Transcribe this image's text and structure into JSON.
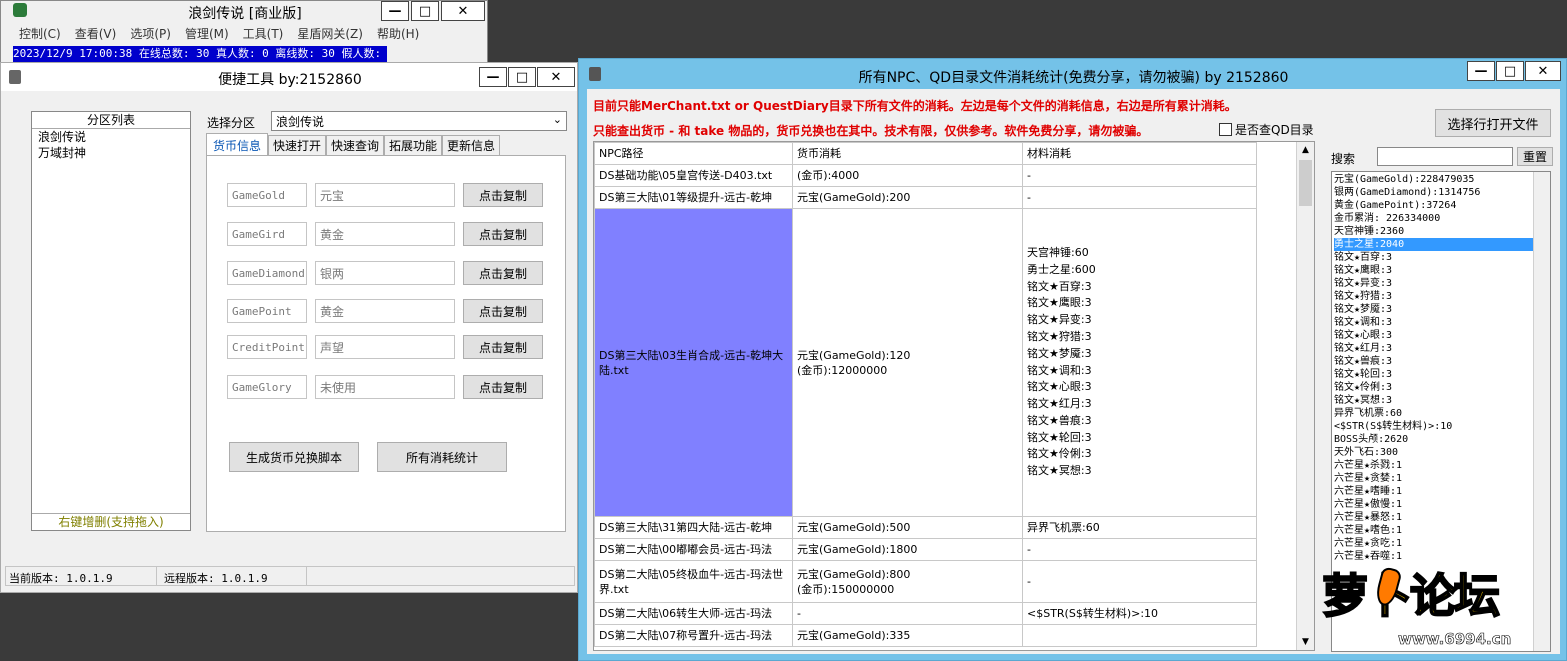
{
  "main_window": {
    "title": "浪剑传说 [商业版]",
    "menu": [
      "控制(C)",
      "查看(V)",
      "选项(P)",
      "管理(M)",
      "工具(T)",
      "星盾网关(Z)",
      "帮助(H)"
    ],
    "status_line": "2023/12/9 17:00:38 在线总数: 30 真人数: 0 离线数: 30 假人数: 0"
  },
  "tool_window": {
    "title": "便捷工具  by:2152860",
    "partition_list_header": "分区列表",
    "partitions": [
      "浪剑传说",
      "万域封神"
    ],
    "list_footer": "右键增删(支持拖入)",
    "select_label": "选择分区",
    "selected_partition": "浪剑传说",
    "tabs": [
      "货币信息",
      "快速打开",
      "快速查询",
      "拓展功能",
      "更新信息"
    ],
    "currencies": [
      {
        "code": "GameGold",
        "name": "元宝",
        "button": "点击复制"
      },
      {
        "code": "GameGird",
        "name": "黄金",
        "button": "点击复制"
      },
      {
        "code": "GameDiamond",
        "name": "银两",
        "button": "点击复制"
      },
      {
        "code": "GamePoint",
        "name": "黄金",
        "button": "点击复制"
      },
      {
        "code": "CreditPoint",
        "name": "声望",
        "button": "点击复制"
      },
      {
        "code": "GameGlory",
        "name": "未使用",
        "button": "点击复制"
      }
    ],
    "gen_button": "生成货币兑换脚本",
    "stats_button": "所有消耗统计",
    "status_local": "当前版本: 1.0.1.9",
    "status_remote": "远程版本: 1.0.1.9"
  },
  "stats_window": {
    "title": "所有NPC、QD目录文件消耗统计(免费分享，请勿被骗)    by 2152860",
    "notice1": "目前只能MerChant.txt or QuestDiary目录下所有文件的消耗。左边是每个文件的消耗信息，右边是所有累计消耗。",
    "notice2": "只能查出货币 - 和 take 物品的，货币兑换也在其中。技术有限，仅供参考。软件免费分享，请勿被骗。",
    "checkbox_label": "是否查QD目录",
    "open_button": "选择行打开文件",
    "search_label": "搜索",
    "reset_button": "重置",
    "columns": [
      "NPC路径",
      "货币消耗",
      "材料消耗"
    ],
    "rows": [
      {
        "path": "DS基础功能\\05皇宫传送-D403.txt",
        "currency": "(金币):4000",
        "material": "-"
      },
      {
        "path": "DS第三大陆\\01等级提升-远古-乾坤",
        "currency": "元宝(GameGold):200",
        "material": "-"
      },
      {
        "path": "DS第三大陆\\03生肖合成-远古-乾坤大陆.txt",
        "currency": "元宝(GameGold):120\n(金币):12000000",
        "material": "天宫神锤:60\n勇士之星:600\n铭文★百穿:3\n铭文★鹰眼:3\n铭文★异变:3\n铭文★狩猎:3\n铭文★梦魇:3\n铭文★调和:3\n铭文★心眼:3\n铭文★红月:3\n铭文★兽痕:3\n铭文★轮回:3\n铭文★伶俐:3\n铭文★冥想:3"
      },
      {
        "path": "DS第三大陆\\31第四大陆-远古-乾坤",
        "currency": "元宝(GameGold):500",
        "material": "异界飞机票:60"
      },
      {
        "path": "DS第二大陆\\00嘟嘟会员-远古-玛法",
        "currency": "元宝(GameGold):1800",
        "material": "-"
      },
      {
        "path": "DS第二大陆\\05终极血牛-远古-玛法世界.txt",
        "currency": "元宝(GameGold):800\n(金币):150000000",
        "material": "-"
      },
      {
        "path": "DS第二大陆\\06转生大师-远古-玛法",
        "currency": "-",
        "material": "<$STR(S$转生材料)>:10"
      },
      {
        "path": "DS第二大陆\\07称号置升-远古-玛法",
        "currency": "元宝(GameGold):335",
        "material": ""
      }
    ],
    "summary": [
      "元宝(GameGold):228479035",
      "银两(GameDiamond):1314756",
      "黄金(GamePoint):37264",
      "金币累消: 226334000",
      "天宫神锤:2360",
      "勇士之星:2040",
      "铭文★百穿:3",
      "铭文★鹰眼:3",
      "铭文★异变:3",
      "铭文★狩猎:3",
      "铭文★梦魇:3",
      "铭文★调和:3",
      "铭文★心眼:3",
      "铭文★红月:3",
      "铭文★兽痕:3",
      "铭文★轮回:3",
      "铭文★伶俐:3",
      "铭文★冥想:3",
      "异界飞机票:60",
      "<$STR(S$转生材料)>:10",
      "BOSS头颅:2620",
      "天外飞石:300",
      "六芒星★杀戮:1",
      "六芒星★贪婪:1",
      "六芒星★嗜睡:1",
      "六芒星★傲慢:1",
      "六芒星★暴怒:1",
      "六芒星★嗜色:1",
      "六芒星★贪吃:1",
      "六芒星★吞噬:1"
    ],
    "selected_summary_index": 5
  },
  "watermark": {
    "text": "萝卜论坛",
    "url": "www.6994.cn"
  },
  "colors": {
    "title_blue": "#74c2e8",
    "highlight": "#8080ff",
    "select_blue": "#3399ff",
    "notice_red": "#e00000",
    "status_blue": "#0000cc"
  }
}
